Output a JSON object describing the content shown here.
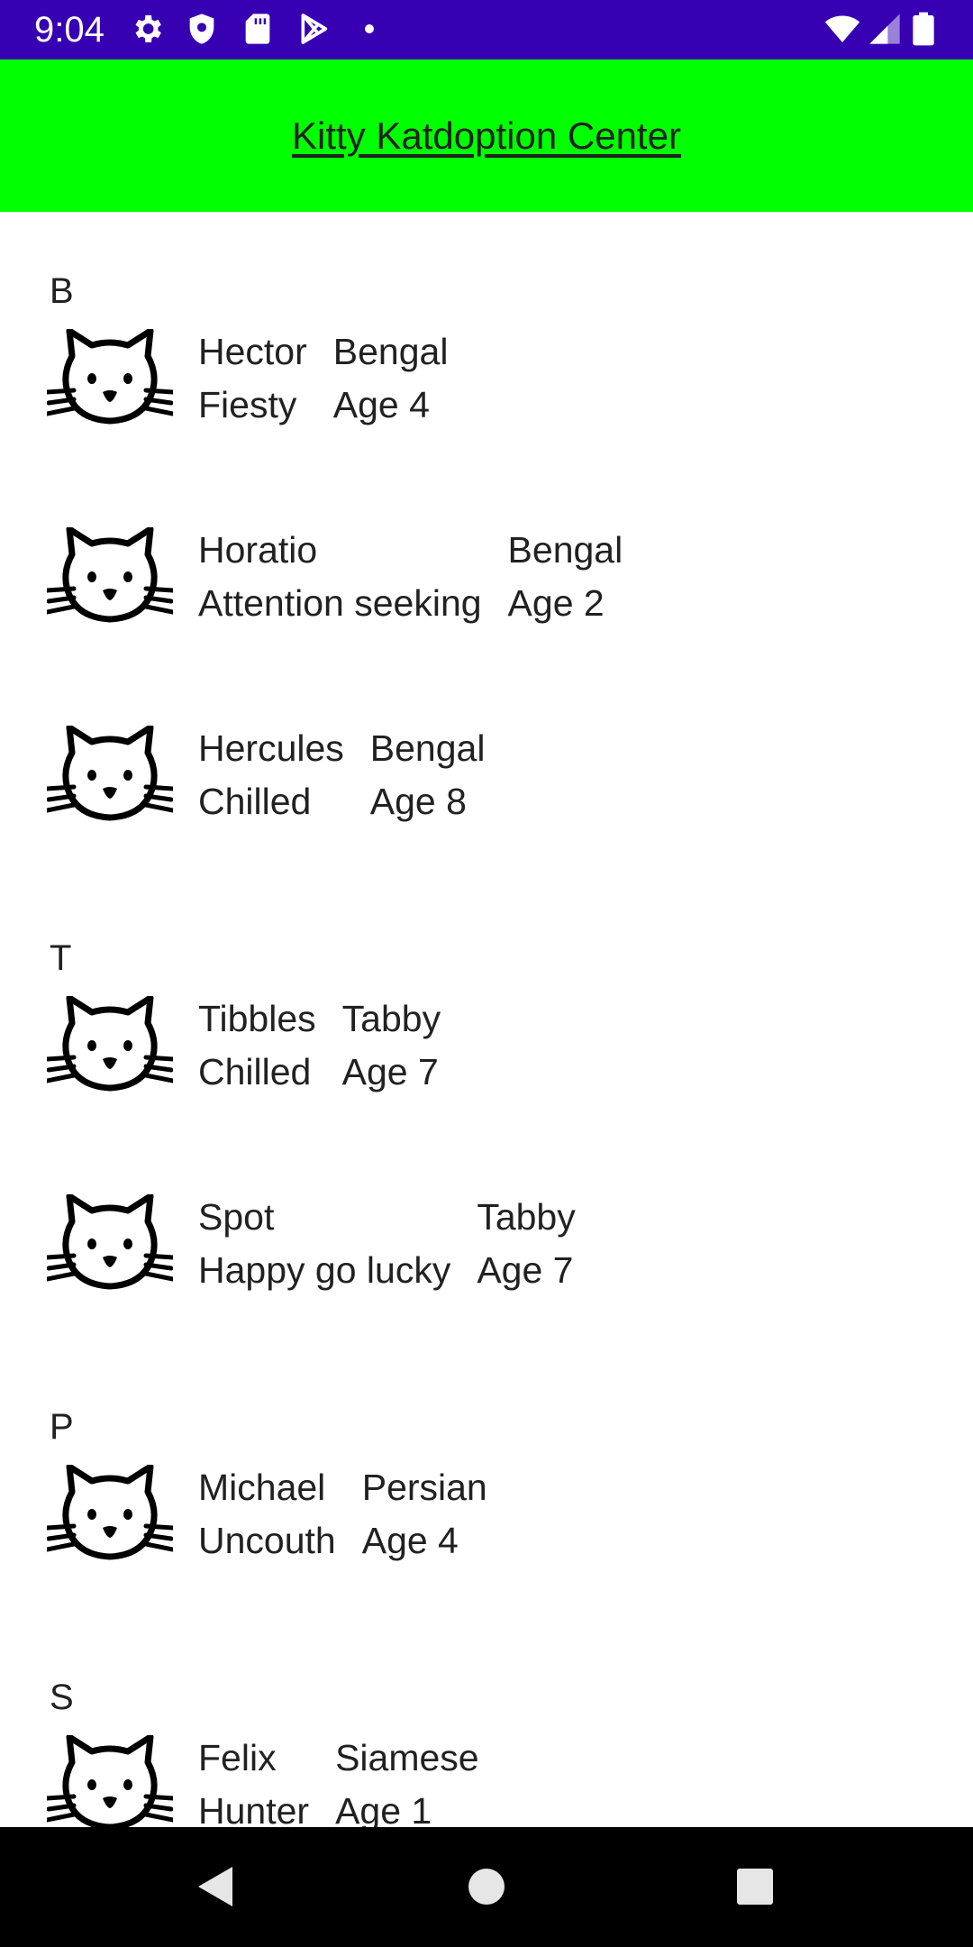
{
  "status_bar": {
    "time": "9:04",
    "left_icons": [
      "gear-icon",
      "shield-icon",
      "sd-card-icon",
      "play-store-icon",
      "dot-icon"
    ],
    "right_icons": [
      "wifi-icon",
      "cell-signal-icon",
      "battery-icon"
    ]
  },
  "app_bar": {
    "title": "Kitty Katdoption Center",
    "background": "#00ff00"
  },
  "sections": [
    {
      "letter": "B",
      "cats": [
        {
          "name": "Hector",
          "temperament": "Fiesty",
          "breed": "Bengal",
          "age": "Age 4"
        },
        {
          "name": "Horatio",
          "temperament": "Attention seeking",
          "breed": "Bengal",
          "age": "Age 2"
        },
        {
          "name": "Hercules",
          "temperament": "Chilled",
          "breed": "Bengal",
          "age": "Age 8"
        }
      ]
    },
    {
      "letter": "T",
      "cats": [
        {
          "name": "Tibbles",
          "temperament": "Chilled",
          "breed": "Tabby",
          "age": "Age 7"
        },
        {
          "name": "Spot",
          "temperament": "Happy go lucky",
          "breed": "Tabby",
          "age": "Age 7"
        }
      ]
    },
    {
      "letter": "P",
      "cats": [
        {
          "name": "Michael",
          "temperament": "Uncouth",
          "breed": "Persian",
          "age": "Age 4"
        }
      ]
    },
    {
      "letter": "S",
      "cats": [
        {
          "name": "Felix",
          "temperament": "Hunter",
          "breed": "Siamese",
          "age": "Age 1"
        }
      ]
    }
  ],
  "nav_bar": {
    "buttons": [
      "back-icon",
      "home-icon",
      "recents-icon"
    ]
  },
  "colors": {
    "status_bar": "#3700b3",
    "app_bar": "#00ff00",
    "nav_bar": "#000000",
    "text": "#212121"
  }
}
